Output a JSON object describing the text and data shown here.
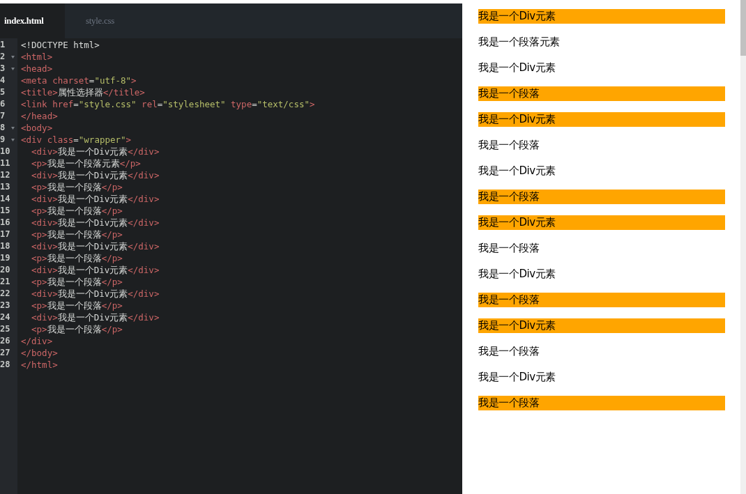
{
  "editor": {
    "tabs": [
      {
        "label": "index.html",
        "selected": true
      },
      {
        "label": "style.css",
        "selected": false
      }
    ],
    "lines": [
      {
        "number": "1",
        "foldable": false,
        "tokens": [
          {
            "kind": "text",
            "text": "<!DOCTYPE html>"
          }
        ]
      },
      {
        "number": "2",
        "foldable": true,
        "tokens": [
          {
            "kind": "tag",
            "text": "<html>"
          }
        ]
      },
      {
        "number": "3",
        "foldable": true,
        "tokens": [
          {
            "kind": "tag",
            "text": "<head>"
          }
        ]
      },
      {
        "number": "4",
        "foldable": false,
        "tokens": [
          {
            "kind": "tag",
            "text": "<meta "
          },
          {
            "kind": "attr",
            "text": "charset"
          },
          {
            "kind": "text",
            "text": "="
          },
          {
            "kind": "string",
            "text": "\"utf-8\""
          },
          {
            "kind": "tag",
            "text": ">"
          }
        ]
      },
      {
        "number": "5",
        "foldable": false,
        "tokens": [
          {
            "kind": "tag",
            "text": "<title>"
          },
          {
            "kind": "text",
            "text": "属性选择器"
          },
          {
            "kind": "tag",
            "text": "</title>"
          }
        ]
      },
      {
        "number": "6",
        "foldable": false,
        "tokens": [
          {
            "kind": "tag",
            "text": "<link "
          },
          {
            "kind": "attr",
            "text": "href"
          },
          {
            "kind": "text",
            "text": "="
          },
          {
            "kind": "string",
            "text": "\"style.css\""
          },
          {
            "kind": "attr",
            "text": " rel"
          },
          {
            "kind": "text",
            "text": "="
          },
          {
            "kind": "string",
            "text": "\"stylesheet\""
          },
          {
            "kind": "attr",
            "text": " type"
          },
          {
            "kind": "text",
            "text": "="
          },
          {
            "kind": "string",
            "text": "\"text/css\""
          },
          {
            "kind": "tag",
            "text": ">"
          }
        ]
      },
      {
        "number": "7",
        "foldable": false,
        "tokens": [
          {
            "kind": "tag",
            "text": "</head>"
          }
        ]
      },
      {
        "number": "8",
        "foldable": true,
        "tokens": [
          {
            "kind": "tag",
            "text": "<body>"
          }
        ]
      },
      {
        "number": "9",
        "foldable": true,
        "tokens": [
          {
            "kind": "tag",
            "text": "<div "
          },
          {
            "kind": "attr",
            "text": "class"
          },
          {
            "kind": "text",
            "text": "="
          },
          {
            "kind": "string",
            "text": "\"wrapper\""
          },
          {
            "kind": "tag",
            "text": ">"
          }
        ]
      },
      {
        "number": "10",
        "foldable": false,
        "tokens": [
          {
            "kind": "tag",
            "text": "  <div>"
          },
          {
            "kind": "text",
            "text": "我是一个Div元素"
          },
          {
            "kind": "tag",
            "text": "</div>"
          }
        ]
      },
      {
        "number": "11",
        "foldable": false,
        "tokens": [
          {
            "kind": "tag",
            "text": "  <p>"
          },
          {
            "kind": "text",
            "text": "我是一个段落元素"
          },
          {
            "kind": "tag",
            "text": "</p>"
          }
        ]
      },
      {
        "number": "12",
        "foldable": false,
        "tokens": [
          {
            "kind": "tag",
            "text": "  <div>"
          },
          {
            "kind": "text",
            "text": "我是一个Div元素"
          },
          {
            "kind": "tag",
            "text": "</div>"
          }
        ]
      },
      {
        "number": "13",
        "foldable": false,
        "tokens": [
          {
            "kind": "tag",
            "text": "  <p>"
          },
          {
            "kind": "text",
            "text": "我是一个段落"
          },
          {
            "kind": "tag",
            "text": "</p>"
          }
        ]
      },
      {
        "number": "14",
        "foldable": false,
        "tokens": [
          {
            "kind": "tag",
            "text": "  <div>"
          },
          {
            "kind": "text",
            "text": "我是一个Div元素"
          },
          {
            "kind": "tag",
            "text": "</div>"
          }
        ]
      },
      {
        "number": "15",
        "foldable": false,
        "tokens": [
          {
            "kind": "tag",
            "text": "  <p>"
          },
          {
            "kind": "text",
            "text": "我是一个段落"
          },
          {
            "kind": "tag",
            "text": "</p>"
          }
        ]
      },
      {
        "number": "16",
        "foldable": false,
        "tokens": [
          {
            "kind": "tag",
            "text": "  <div>"
          },
          {
            "kind": "text",
            "text": "我是一个Div元素"
          },
          {
            "kind": "tag",
            "text": "</div>"
          }
        ]
      },
      {
        "number": "17",
        "foldable": false,
        "tokens": [
          {
            "kind": "tag",
            "text": "  <p>"
          },
          {
            "kind": "text",
            "text": "我是一个段落"
          },
          {
            "kind": "tag",
            "text": "</p>"
          }
        ]
      },
      {
        "number": "18",
        "foldable": false,
        "tokens": [
          {
            "kind": "tag",
            "text": "  <div>"
          },
          {
            "kind": "text",
            "text": "我是一个Div元素"
          },
          {
            "kind": "tag",
            "text": "</div>"
          }
        ]
      },
      {
        "number": "19",
        "foldable": false,
        "tokens": [
          {
            "kind": "tag",
            "text": "  <p>"
          },
          {
            "kind": "text",
            "text": "我是一个段落"
          },
          {
            "kind": "tag",
            "text": "</p>"
          }
        ]
      },
      {
        "number": "20",
        "foldable": false,
        "tokens": [
          {
            "kind": "tag",
            "text": "  <div>"
          },
          {
            "kind": "text",
            "text": "我是一个Div元素"
          },
          {
            "kind": "tag",
            "text": "</div>"
          }
        ]
      },
      {
        "number": "21",
        "foldable": false,
        "tokens": [
          {
            "kind": "tag",
            "text": "  <p>"
          },
          {
            "kind": "text",
            "text": "我是一个段落"
          },
          {
            "kind": "tag",
            "text": "</p>"
          }
        ]
      },
      {
        "number": "22",
        "foldable": false,
        "tokens": [
          {
            "kind": "tag",
            "text": "  <div>"
          },
          {
            "kind": "text",
            "text": "我是一个Div元素"
          },
          {
            "kind": "tag",
            "text": "</div>"
          }
        ]
      },
      {
        "number": "23",
        "foldable": false,
        "tokens": [
          {
            "kind": "tag",
            "text": "  <p>"
          },
          {
            "kind": "text",
            "text": "我是一个段落"
          },
          {
            "kind": "tag",
            "text": "</p>"
          }
        ]
      },
      {
        "number": "24",
        "foldable": false,
        "tokens": [
          {
            "kind": "tag",
            "text": "  <div>"
          },
          {
            "kind": "text",
            "text": "我是一个Div元素"
          },
          {
            "kind": "tag",
            "text": "</div>"
          }
        ]
      },
      {
        "number": "25",
        "foldable": false,
        "tokens": [
          {
            "kind": "tag",
            "text": "  <p>"
          },
          {
            "kind": "text",
            "text": "我是一个段落"
          },
          {
            "kind": "tag",
            "text": "</p>"
          }
        ]
      },
      {
        "number": "26",
        "foldable": false,
        "tokens": [
          {
            "kind": "tag",
            "text": "</div>"
          }
        ]
      },
      {
        "number": "27",
        "foldable": false,
        "tokens": [
          {
            "kind": "tag",
            "text": "</body>"
          }
        ]
      },
      {
        "number": "28",
        "foldable": false,
        "tokens": [
          {
            "kind": "tag",
            "text": "</html>"
          }
        ]
      }
    ]
  },
  "preview": {
    "items": [
      {
        "text": "我是一个Div元素",
        "highlighted": true
      },
      {
        "text": "我是一个段落元素",
        "highlighted": false
      },
      {
        "text": "我是一个Div元素",
        "highlighted": false
      },
      {
        "text": "我是一个段落",
        "highlighted": true
      },
      {
        "text": "我是一个Div元素",
        "highlighted": true
      },
      {
        "text": "我是一个段落",
        "highlighted": false
      },
      {
        "text": "我是一个Div元素",
        "highlighted": false
      },
      {
        "text": "我是一个段落",
        "highlighted": true
      },
      {
        "text": "我是一个Div元素",
        "highlighted": true
      },
      {
        "text": "我是一个段落",
        "highlighted": false
      },
      {
        "text": "我是一个Div元素",
        "highlighted": false
      },
      {
        "text": "我是一个段落",
        "highlighted": true
      },
      {
        "text": "我是一个Div元素",
        "highlighted": true
      },
      {
        "text": "我是一个段落",
        "highlighted": false
      },
      {
        "text": "我是一个Div元素",
        "highlighted": false
      },
      {
        "text": "我是一个段落",
        "highlighted": true
      }
    ]
  }
}
